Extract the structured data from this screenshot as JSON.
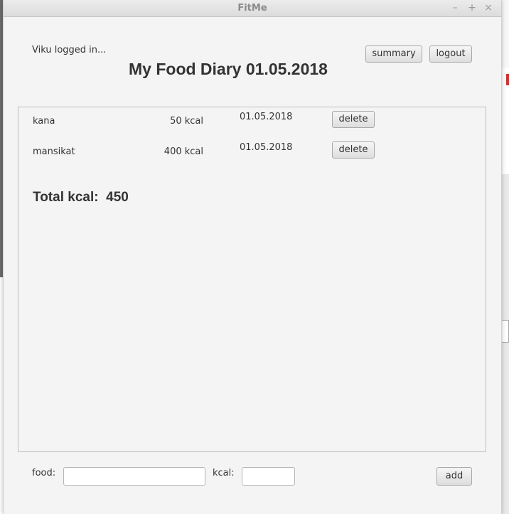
{
  "window": {
    "title": "FitMe",
    "controls": {
      "minimize": "–",
      "maximize": "+",
      "close": "×"
    }
  },
  "header": {
    "logged_in_text": "Viku logged in...",
    "title": "My Food Diary 01.05.2018",
    "summary_label": "summary",
    "logout_label": "logout"
  },
  "entries": [
    {
      "name": "kana",
      "kcal": "50 kcal",
      "date": "01.05.2018",
      "delete_label": "delete"
    },
    {
      "name": "mansikat",
      "kcal": "400 kcal",
      "date": "01.05.2018",
      "delete_label": "delete"
    }
  ],
  "total": {
    "label": "Total kcal:",
    "value": "450"
  },
  "form": {
    "food_label": "food:",
    "food_value": "",
    "kcal_label": "kcal:",
    "kcal_value": "",
    "add_label": "add"
  }
}
